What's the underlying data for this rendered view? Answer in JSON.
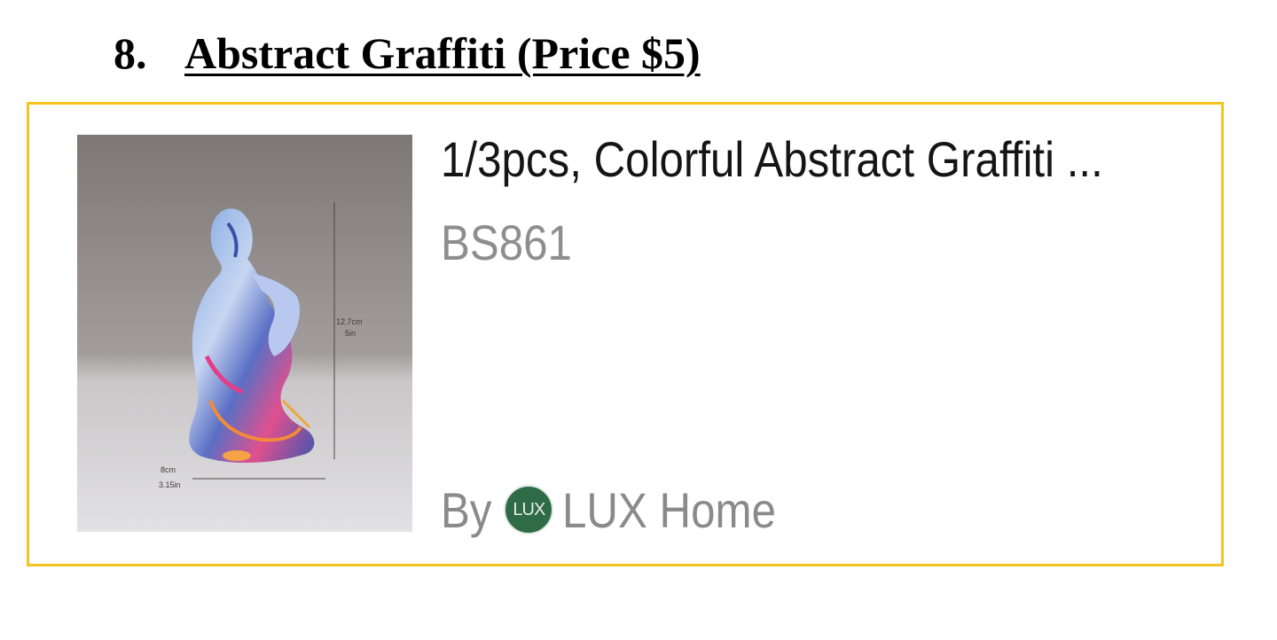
{
  "heading": {
    "number": "8.",
    "title": "Abstract Graffiti (Price $5)"
  },
  "product": {
    "title": "1/3pcs, Colorful Abstract Graffiti ...",
    "sku": "BS861",
    "image": {
      "dimension_height_cm": "12.7cm",
      "dimension_height_in": "5in",
      "dimension_width_cm": "8cm",
      "dimension_width_in": "3.15in"
    },
    "seller": {
      "prefix": "By",
      "logo_text": "LUX",
      "name": "LUX Home"
    }
  },
  "colors": {
    "card_border": "#f4c322",
    "seller_logo": "#2e6b46"
  }
}
